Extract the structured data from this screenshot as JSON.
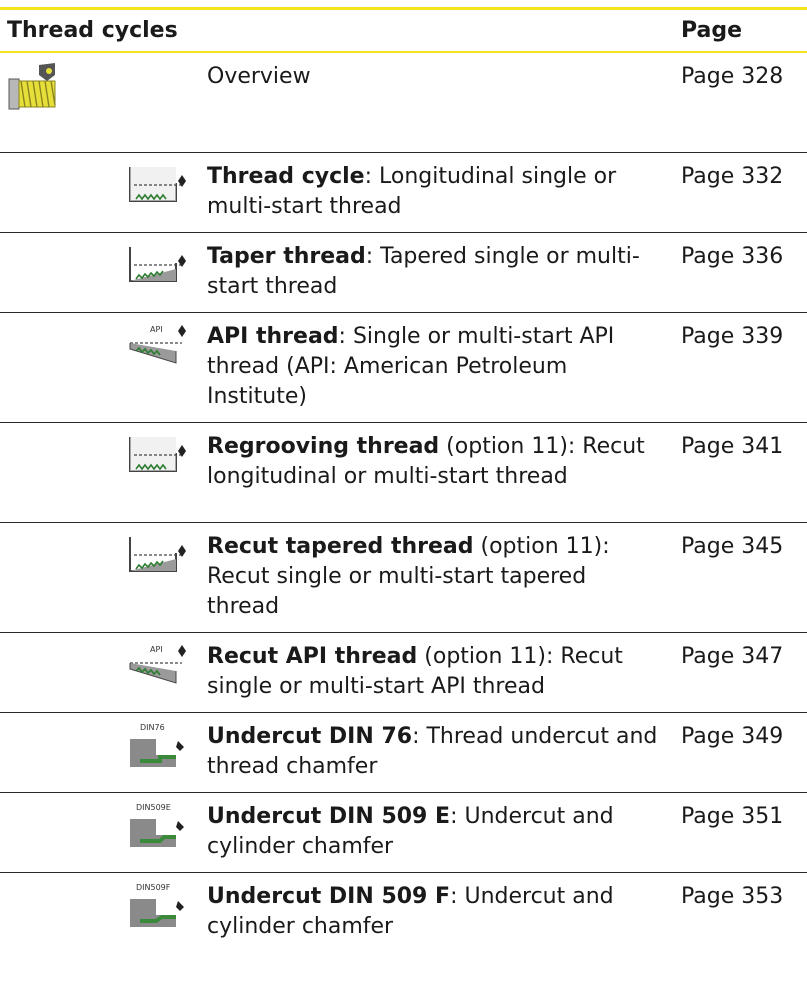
{
  "header": {
    "col1": "Thread cycles",
    "col2": "",
    "col3": "Page"
  },
  "rows": [
    {
      "icon": "thread-overview-icon",
      "name": "",
      "desc": "Overview",
      "page": "Page 328"
    },
    {
      "icon": "thread-cycle-icon",
      "name": "Thread cycle",
      "desc": ": Longitudinal single or multi-start thread",
      "page": "Page 332"
    },
    {
      "icon": "taper-thread-icon",
      "name": "Taper thread",
      "desc": ": Tapered single or multi-start thread",
      "page": "Page 336"
    },
    {
      "icon": "api-thread-icon",
      "name": "API thread",
      "desc": ": Single or multi-start API thread (API: American Petroleum Institute)",
      "page": "Page 339"
    },
    {
      "icon": "regrooving-thread-icon",
      "name": "Regrooving thread",
      "desc": " (option 11): Recut longitudinal or multi-start thread",
      "page": "Page 341"
    },
    {
      "icon": "recut-tapered-thread-icon",
      "name": "Recut tapered thread",
      "desc": " (option 11): Recut single or multi-start tapered thread",
      "page": "Page 345"
    },
    {
      "icon": "recut-api-thread-icon",
      "name": "Recut API thread",
      "desc": " (option 11): Recut single or multi-start API thread",
      "page": "Page 347"
    },
    {
      "icon": "undercut-din76-icon",
      "name": "Undercut DIN 76",
      "desc": ": Thread undercut and thread chamfer",
      "page": "Page 349"
    },
    {
      "icon": "undercut-din509e-icon",
      "name": "Undercut DIN 509 E",
      "desc": ": Undercut and cylinder chamfer",
      "page": "Page 351"
    },
    {
      "icon": "undercut-din509f-icon",
      "name": "Undercut DIN 509 F",
      "desc": ": Undercut and cylinder chamfer",
      "page": "Page 353"
    }
  ],
  "icon_labels": {
    "api": "API",
    "din76": "DIN76",
    "din509e": "DIN509E",
    "din509f": "DIN509F"
  },
  "colors": {
    "accent_rule": "#f4e31d",
    "icon_thread": "#e6df3a",
    "icon_base": "#3b8a3b"
  }
}
